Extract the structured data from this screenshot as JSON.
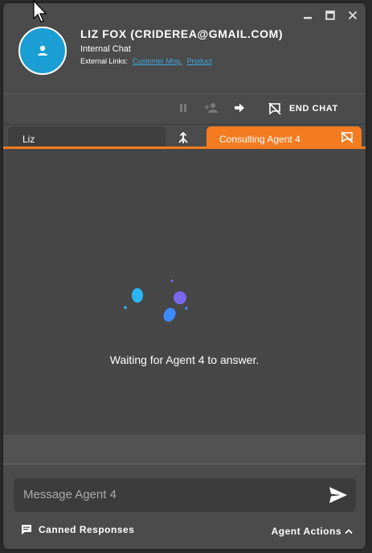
{
  "window_controls": {
    "minimize_icon": "minimize-icon",
    "maximize_icon": "maximize-icon",
    "close_icon": "close-icon"
  },
  "contact": {
    "name": "LIZ FOX (CRIDEREA@GMAIL.COM)",
    "chat_type": "Internal Chat",
    "external_links_label": "External Links:",
    "external_links": [
      "Customer Mng.",
      "Product"
    ],
    "avatar_color": "#1a9ed4"
  },
  "toolbar": {
    "end_chat_label": "END CHAT",
    "icons": [
      "pause-icon",
      "add-person-icon",
      "forward-arrow-icon",
      "end-chat-icon"
    ]
  },
  "tabs": {
    "customer_tab": "Liz",
    "agent_tab": "Consulting Agent 4",
    "accent_color": "#f47b20"
  },
  "chat": {
    "status_text": "Waiting for Agent 4 to answer."
  },
  "composer": {
    "placeholder": "Message Agent 4"
  },
  "bottom": {
    "canned_label": "Canned Responses",
    "agent_actions_label": "Agent Actions"
  }
}
